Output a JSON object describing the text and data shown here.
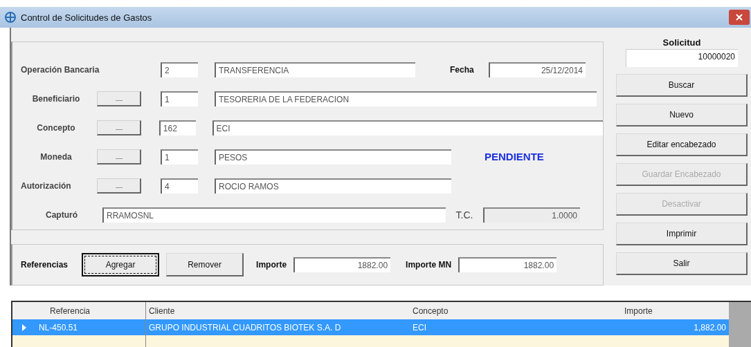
{
  "window": {
    "title": "Control de Solicitudes de Gastos"
  },
  "header_fields": [
    {
      "label": "Operación Bancaria",
      "lookup_button": false,
      "code": "2",
      "description": "TRANSFERENCIA"
    },
    {
      "label": "Beneficiario",
      "lookup_button": true,
      "code": "1",
      "description": "TESORERIA DE LA FEDERACION"
    },
    {
      "label": "Concepto",
      "lookup_button": true,
      "code": "162",
      "description": "ECI"
    },
    {
      "label": "Moneda",
      "lookup_button": true,
      "code": "1",
      "description": "PESOS"
    },
    {
      "label": "Autorización",
      "lookup_button": true,
      "code": "4",
      "description": "ROCIO RAMOS"
    }
  ],
  "fecha": {
    "label": "Fecha",
    "value": "25/12/2014"
  },
  "status": "PENDIENTE",
  "capturo": {
    "label": "Capturó",
    "value": "RRAMOSNL"
  },
  "tipo_cambio": {
    "label": "T.C.",
    "value": "1.0000"
  },
  "referencias": {
    "label": "Referencias",
    "buttons": [
      {
        "label": "Agregar",
        "focused": true
      },
      {
        "label": "Remover",
        "focused": false
      }
    ],
    "importe": {
      "label": "Importe",
      "value": "1882.00"
    },
    "importe_mn": {
      "label": "Importe MN",
      "value": "1882.00"
    }
  },
  "solicitud": {
    "label": "Solicitud",
    "value": "10000020"
  },
  "actions": [
    {
      "label": "Buscar",
      "disabled": false
    },
    {
      "label": "Nuevo",
      "disabled": false
    },
    {
      "label": "Editar encabezado",
      "disabled": false
    },
    {
      "label": "Guardar Encabezado",
      "disabled": true
    },
    {
      "label": "Desactivar",
      "disabled": true
    },
    {
      "label": "Imprimir",
      "disabled": false
    },
    {
      "label": "Salir",
      "disabled": false
    }
  ],
  "table": {
    "columns": [
      "Referencia",
      "Cliente",
      "Concepto",
      "Importe"
    ],
    "rows": [
      {
        "selected": true,
        "cells": [
          "NL-450.51",
          "GRUPO INDUSTRIAL CUADRITOS BIOTEK S.A. D",
          "ECI",
          "1,882.00"
        ]
      }
    ]
  }
}
